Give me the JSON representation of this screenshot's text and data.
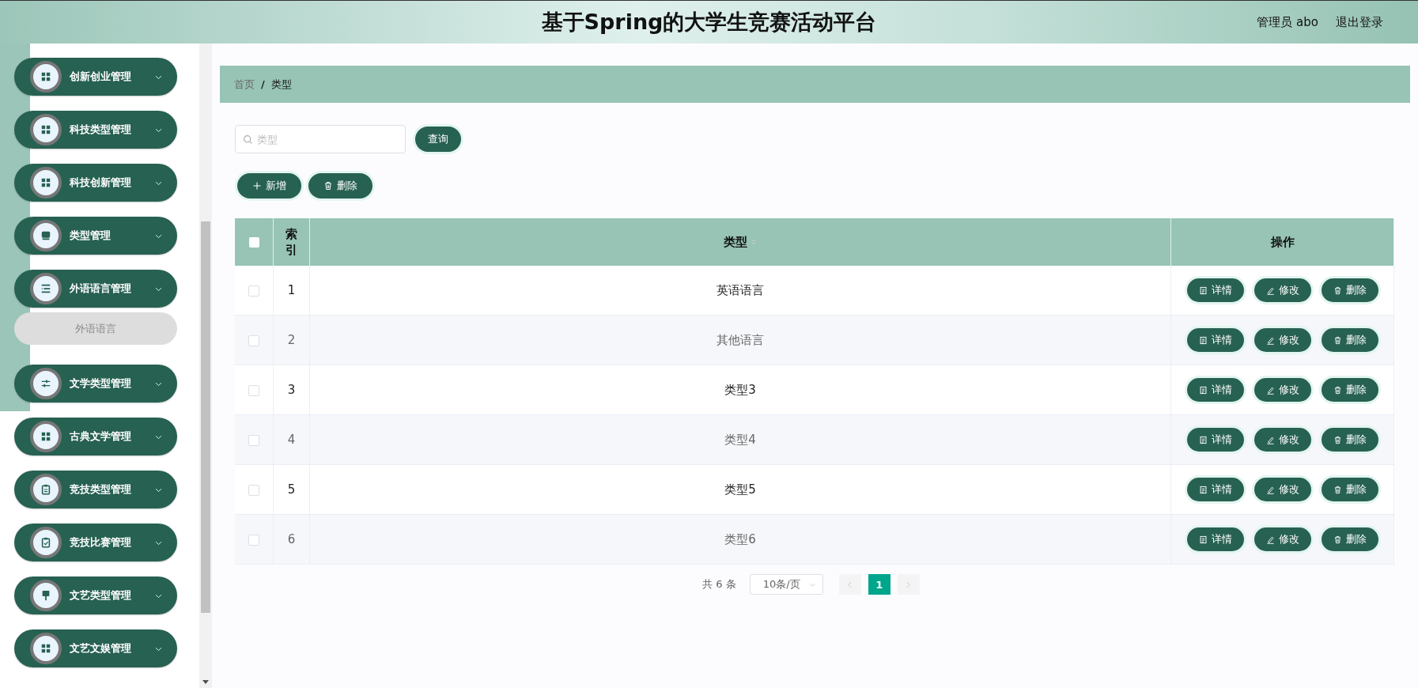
{
  "header": {
    "title": "基于Spring的大学生竞赛活动平台",
    "user": "管理员 abo",
    "logout": "退出登录"
  },
  "sidebar": {
    "items": [
      {
        "label": "创新创业管理"
      },
      {
        "label": "科技类型管理"
      },
      {
        "label": "科技创新管理"
      },
      {
        "label": "类型管理"
      },
      {
        "label": "外语语言管理",
        "children": [
          {
            "label": "外语语言",
            "selected": true
          }
        ]
      },
      {
        "label": "文学类型管理"
      },
      {
        "label": "古典文学管理"
      },
      {
        "label": "竞技类型管理"
      },
      {
        "label": "竞技比赛管理"
      },
      {
        "label": "文艺类型管理"
      },
      {
        "label": "文艺文娱管理"
      }
    ]
  },
  "breadcrumb": {
    "items": [
      "首页",
      "类型"
    ],
    "separator": "/"
  },
  "search": {
    "placeholder": "类型",
    "button": "查询"
  },
  "actions": [
    "新增",
    "删除"
  ],
  "table": {
    "all_checked": false,
    "columns": [
      "索引",
      "类型",
      "操作"
    ],
    "rows": [
      {
        "checked": false,
        "index": "1",
        "type": "英语语言",
        "actions": [
          "详情",
          "修改",
          "删除"
        ]
      },
      {
        "checked": false,
        "index": "2",
        "type": "其他语言",
        "actions": [
          "详情",
          "修改",
          "删除"
        ]
      },
      {
        "checked": false,
        "index": "3",
        "type": "类型3",
        "actions": [
          "详情",
          "修改",
          "删除"
        ]
      },
      {
        "checked": false,
        "index": "4",
        "type": "类型4",
        "actions": [
          "详情",
          "修改",
          "删除"
        ]
      },
      {
        "checked": false,
        "index": "5",
        "type": "类型5",
        "actions": [
          "详情",
          "修改",
          "删除"
        ]
      },
      {
        "checked": false,
        "index": "6",
        "type": "类型6",
        "actions": [
          "详情",
          "修改",
          "删除"
        ]
      }
    ]
  },
  "pagination": {
    "total": "共 6 条",
    "page_size": "10条/页",
    "pages": [
      {
        "label": "1",
        "selected": true
      }
    ]
  }
}
